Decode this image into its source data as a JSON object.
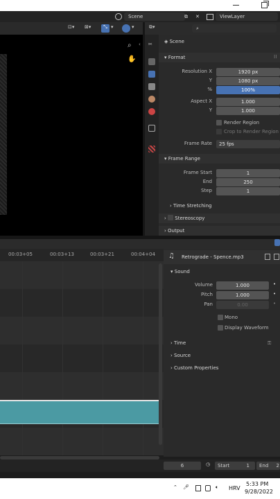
{
  "topbar": {
    "scene_label": "Scene",
    "viewlayer_label": "ViewLayer"
  },
  "properties": {
    "header_scene": "Scene",
    "format": {
      "title": "Format",
      "res_x_label": "Resolution X",
      "res_x": "1920 px",
      "res_y_label": "Y",
      "res_y": "1080 px",
      "percent_label": "%",
      "percent": "100%",
      "aspect_x_label": "Aspect X",
      "aspect_x": "1.000",
      "aspect_y_label": "Y",
      "aspect_y": "1.000",
      "render_region": "Render Region",
      "crop_region": "Crop to Render Region",
      "frame_rate_label": "Frame Rate",
      "frame_rate": "25 fps"
    },
    "frame_range": {
      "title": "Frame Range",
      "start_label": "Frame Start",
      "start": "1",
      "end_label": "End",
      "end": "250",
      "step_label": "Step",
      "step": "1"
    },
    "time_stretching": "Time Stretching",
    "stereoscopy": "Stereoscopy",
    "output": "Output"
  },
  "sequencer": {
    "ruler": [
      "00:03+05",
      "00:03+13",
      "00:03+21",
      "00:04+04"
    ]
  },
  "strip_panel": {
    "strip_name": "Retrograde - Spence.mp3",
    "sound_title": "Sound",
    "volume_label": "Volume",
    "volume": "1.000",
    "pitch_label": "Pitch",
    "pitch": "1.000",
    "pan_label": "Pan",
    "pan": "0.00",
    "mono": "Mono",
    "display_waveform": "Display Waveform",
    "time": "Time",
    "source": "Source",
    "custom_properties": "Custom Properties"
  },
  "footer": {
    "current_frame": "6",
    "start_label": "Start",
    "start": "1",
    "end_label": "End",
    "end": "2"
  },
  "taskbar": {
    "lang": "HRV",
    "time": "5:33 PM",
    "date": "9/28/2022"
  },
  "colors": {
    "accent": "#4772b3",
    "strip": "#4b9aa3"
  }
}
